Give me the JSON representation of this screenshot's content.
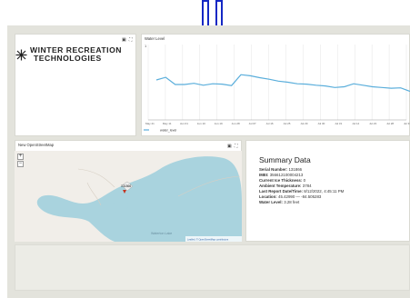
{
  "logo": {
    "line1": "WINTER RECREATION",
    "line2": "TECHNOLOGIES"
  },
  "chart": {
    "title": "Water Level",
    "y_tick_top": "1",
    "legend": "water_level"
  },
  "chart_data": {
    "type": "line",
    "title": "Water Level",
    "x": [
      "May 21",
      "May 11",
      "Jun 01",
      "Jun 10",
      "Jun 19",
      "Jun 28",
      "Jul 07",
      "Jul 16",
      "Jul 25",
      "Jul 29",
      "Jul 30",
      "Jul 31",
      "Jul 14",
      "Jul 23",
      "Jul 28",
      "Jul 31"
    ],
    "series": [
      {
        "name": "water_level",
        "values": [
          0.53,
          0.565,
          0.47,
          0.47,
          0.485,
          0.46,
          0.48,
          0.475,
          0.455,
          0.6,
          0.585,
          0.56,
          0.54,
          0.515,
          0.5,
          0.48,
          0.475,
          0.46,
          0.45,
          0.43,
          0.44,
          0.48,
          0.46,
          0.44,
          0.43,
          0.42,
          0.425,
          0.38
        ]
      }
    ],
    "ylim": [
      0,
      1
    ],
    "grid": true,
    "color": "#5aaedb",
    "legend_placement": "bottom-left"
  },
  "map": {
    "title": "New OpenStreetMap",
    "zoom_in": "+",
    "zoom_out": "−",
    "marker_label": "131866",
    "lake_label": "Waterton Lake",
    "attribution": "Leaflet | © OpenStreetMap contributors"
  },
  "summary": {
    "title": "Summary Data",
    "rows": [
      {
        "k": "Serial Number:",
        "v": "131866"
      },
      {
        "k": "IMEI:",
        "v": "356612100004213"
      },
      {
        "k": "Current Ice Thickness:",
        "v": "0"
      },
      {
        "k": "Ambient Temperature:",
        "v": "3784"
      },
      {
        "k": "Last Report Date/Time:",
        "v": "8/12/2022, 4:45:11 PM"
      },
      {
        "k": "Location:",
        "v": "45.42990 — -84.505283"
      },
      {
        "k": "Water Level:",
        "v": "3.28 feet"
      }
    ]
  },
  "icons": {
    "menu": "document-icon",
    "expand": "expand-icon"
  }
}
